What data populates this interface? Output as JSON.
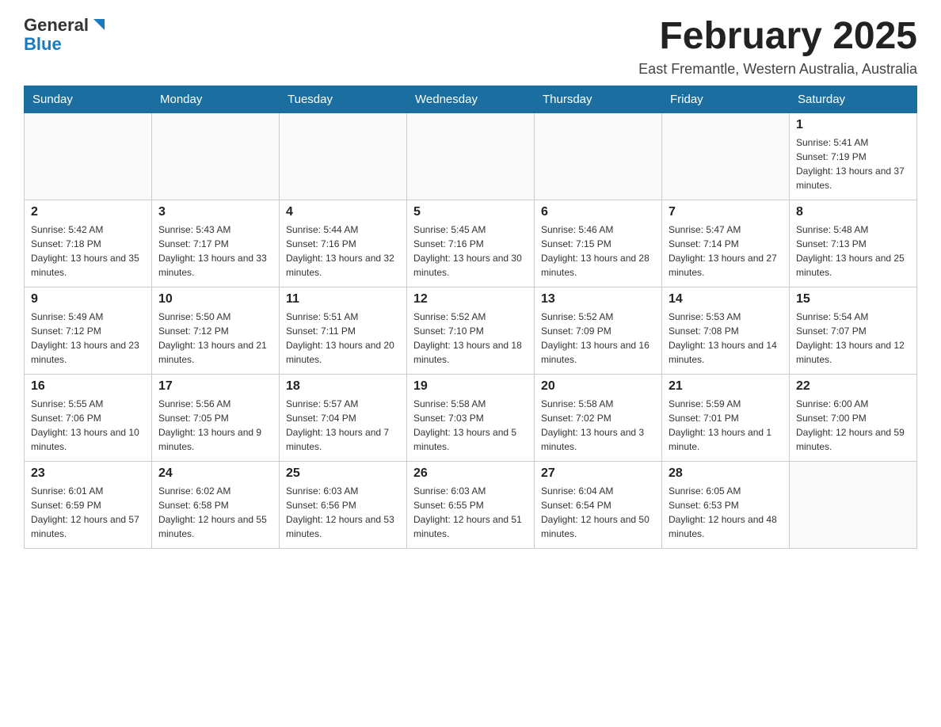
{
  "header": {
    "logo": {
      "general": "General",
      "blue": "Blue"
    },
    "title": "February 2025",
    "subtitle": "East Fremantle, Western Australia, Australia"
  },
  "calendar": {
    "days_of_week": [
      "Sunday",
      "Monday",
      "Tuesday",
      "Wednesday",
      "Thursday",
      "Friday",
      "Saturday"
    ],
    "weeks": [
      [
        {
          "day": "",
          "info": ""
        },
        {
          "day": "",
          "info": ""
        },
        {
          "day": "",
          "info": ""
        },
        {
          "day": "",
          "info": ""
        },
        {
          "day": "",
          "info": ""
        },
        {
          "day": "",
          "info": ""
        },
        {
          "day": "1",
          "info": "Sunrise: 5:41 AM\nSunset: 7:19 PM\nDaylight: 13 hours and 37 minutes."
        }
      ],
      [
        {
          "day": "2",
          "info": "Sunrise: 5:42 AM\nSunset: 7:18 PM\nDaylight: 13 hours and 35 minutes."
        },
        {
          "day": "3",
          "info": "Sunrise: 5:43 AM\nSunset: 7:17 PM\nDaylight: 13 hours and 33 minutes."
        },
        {
          "day": "4",
          "info": "Sunrise: 5:44 AM\nSunset: 7:16 PM\nDaylight: 13 hours and 32 minutes."
        },
        {
          "day": "5",
          "info": "Sunrise: 5:45 AM\nSunset: 7:16 PM\nDaylight: 13 hours and 30 minutes."
        },
        {
          "day": "6",
          "info": "Sunrise: 5:46 AM\nSunset: 7:15 PM\nDaylight: 13 hours and 28 minutes."
        },
        {
          "day": "7",
          "info": "Sunrise: 5:47 AM\nSunset: 7:14 PM\nDaylight: 13 hours and 27 minutes."
        },
        {
          "day": "8",
          "info": "Sunrise: 5:48 AM\nSunset: 7:13 PM\nDaylight: 13 hours and 25 minutes."
        }
      ],
      [
        {
          "day": "9",
          "info": "Sunrise: 5:49 AM\nSunset: 7:12 PM\nDaylight: 13 hours and 23 minutes."
        },
        {
          "day": "10",
          "info": "Sunrise: 5:50 AM\nSunset: 7:12 PM\nDaylight: 13 hours and 21 minutes."
        },
        {
          "day": "11",
          "info": "Sunrise: 5:51 AM\nSunset: 7:11 PM\nDaylight: 13 hours and 20 minutes."
        },
        {
          "day": "12",
          "info": "Sunrise: 5:52 AM\nSunset: 7:10 PM\nDaylight: 13 hours and 18 minutes."
        },
        {
          "day": "13",
          "info": "Sunrise: 5:52 AM\nSunset: 7:09 PM\nDaylight: 13 hours and 16 minutes."
        },
        {
          "day": "14",
          "info": "Sunrise: 5:53 AM\nSunset: 7:08 PM\nDaylight: 13 hours and 14 minutes."
        },
        {
          "day": "15",
          "info": "Sunrise: 5:54 AM\nSunset: 7:07 PM\nDaylight: 13 hours and 12 minutes."
        }
      ],
      [
        {
          "day": "16",
          "info": "Sunrise: 5:55 AM\nSunset: 7:06 PM\nDaylight: 13 hours and 10 minutes."
        },
        {
          "day": "17",
          "info": "Sunrise: 5:56 AM\nSunset: 7:05 PM\nDaylight: 13 hours and 9 minutes."
        },
        {
          "day": "18",
          "info": "Sunrise: 5:57 AM\nSunset: 7:04 PM\nDaylight: 13 hours and 7 minutes."
        },
        {
          "day": "19",
          "info": "Sunrise: 5:58 AM\nSunset: 7:03 PM\nDaylight: 13 hours and 5 minutes."
        },
        {
          "day": "20",
          "info": "Sunrise: 5:58 AM\nSunset: 7:02 PM\nDaylight: 13 hours and 3 minutes."
        },
        {
          "day": "21",
          "info": "Sunrise: 5:59 AM\nSunset: 7:01 PM\nDaylight: 13 hours and 1 minute."
        },
        {
          "day": "22",
          "info": "Sunrise: 6:00 AM\nSunset: 7:00 PM\nDaylight: 12 hours and 59 minutes."
        }
      ],
      [
        {
          "day": "23",
          "info": "Sunrise: 6:01 AM\nSunset: 6:59 PM\nDaylight: 12 hours and 57 minutes."
        },
        {
          "day": "24",
          "info": "Sunrise: 6:02 AM\nSunset: 6:58 PM\nDaylight: 12 hours and 55 minutes."
        },
        {
          "day": "25",
          "info": "Sunrise: 6:03 AM\nSunset: 6:56 PM\nDaylight: 12 hours and 53 minutes."
        },
        {
          "day": "26",
          "info": "Sunrise: 6:03 AM\nSunset: 6:55 PM\nDaylight: 12 hours and 51 minutes."
        },
        {
          "day": "27",
          "info": "Sunrise: 6:04 AM\nSunset: 6:54 PM\nDaylight: 12 hours and 50 minutes."
        },
        {
          "day": "28",
          "info": "Sunrise: 6:05 AM\nSunset: 6:53 PM\nDaylight: 12 hours and 48 minutes."
        },
        {
          "day": "",
          "info": ""
        }
      ]
    ]
  }
}
